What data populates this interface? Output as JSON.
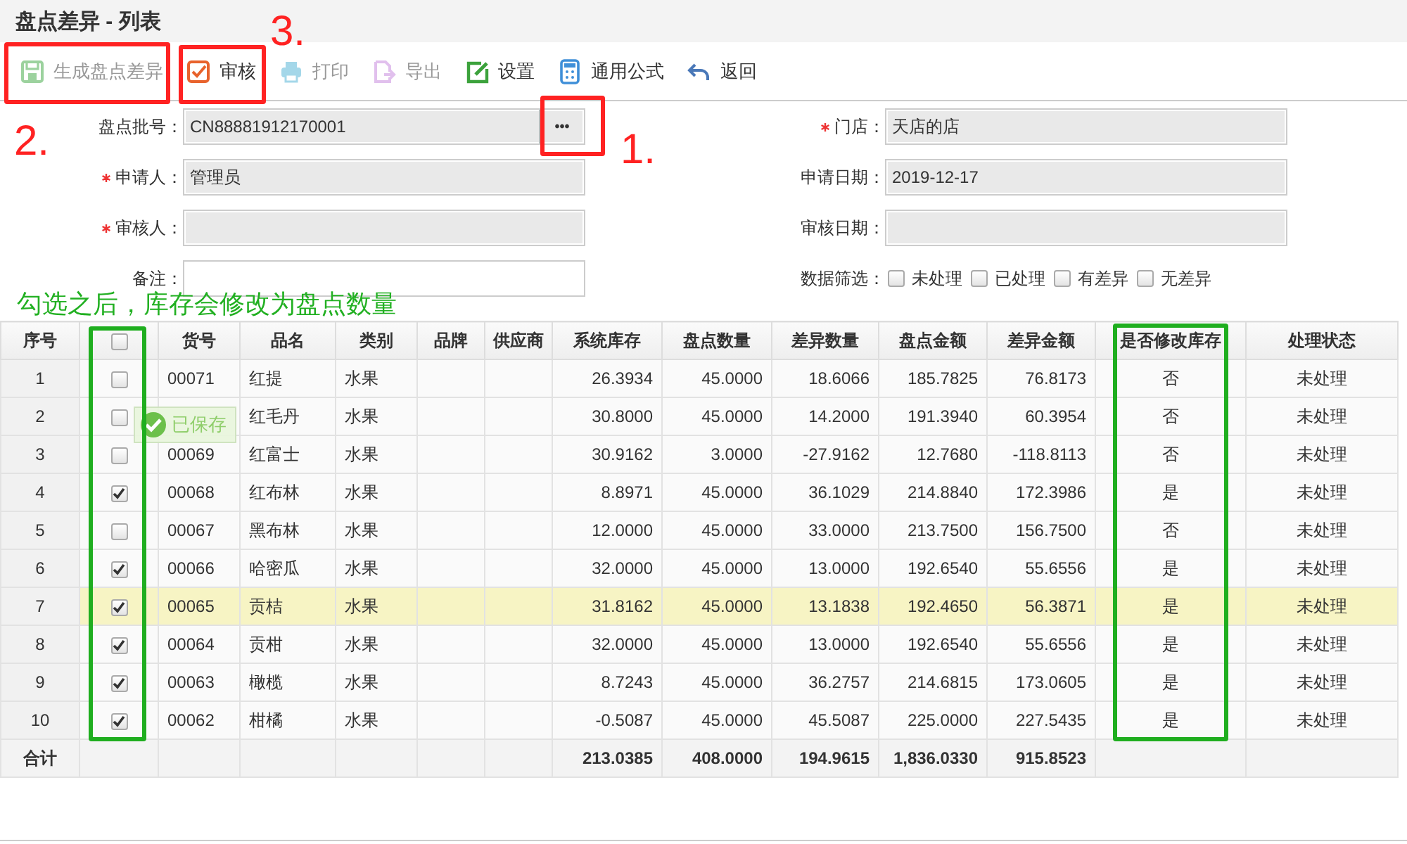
{
  "window": {
    "title": "盘点差异 - 列表"
  },
  "toolbar": [
    {
      "label": "生成盘点差异",
      "kind": "save",
      "disabled": true
    },
    {
      "label": "审核",
      "kind": "check",
      "disabled": false
    },
    {
      "label": "打印",
      "kind": "print",
      "disabled": true
    },
    {
      "label": "导出",
      "kind": "export",
      "disabled": true
    },
    {
      "label": "设置",
      "kind": "edit",
      "disabled": false
    },
    {
      "label": "通用公式",
      "kind": "calc",
      "disabled": false
    },
    {
      "label": "返回",
      "kind": "back",
      "disabled": false
    }
  ],
  "form": {
    "left": [
      {
        "label": "盘点批号：",
        "required": false,
        "value": "CN88881912170001",
        "lookup": "•••"
      },
      {
        "label": "申请人：",
        "required": true,
        "value": "管理员"
      },
      {
        "label": "审核人：",
        "required": true
      },
      {
        "label": "备注：",
        "required": false,
        "editable": true
      }
    ],
    "right": [
      {
        "label": "门店：",
        "required": true,
        "value": "天店的店"
      },
      {
        "label": "申请日期：",
        "required": false,
        "value": "2019-12-17"
      },
      {
        "label": "审核日期：",
        "required": false
      }
    ],
    "filter": {
      "label": "数据筛选：",
      "options": [
        {
          "label": "未处理",
          "checked": false
        },
        {
          "label": "已处理",
          "checked": false
        },
        {
          "label": "有差异",
          "checked": false
        },
        {
          "label": "无差异",
          "checked": false
        }
      ]
    }
  },
  "table": {
    "columns": [
      "序号",
      "货号",
      "品名",
      "类别",
      "品牌",
      "供应商",
      "系统库存",
      "盘点数量",
      "差异数量",
      "盘点金额",
      "差异金额",
      "是否修改库存",
      "处理状态"
    ],
    "header_checked": false,
    "rows": [
      {
        "no": "1",
        "checked": false,
        "selected": false,
        "code": "00071",
        "name": "红提",
        "category": "水果",
        "system_stock": "26.3934",
        "count_qty": "45.0000",
        "diff_qty": "18.6066",
        "count_amount": "185.7825",
        "diff_amount": "76.8173",
        "modify_stock": "否",
        "status": "未处理"
      },
      {
        "no": "2",
        "checked": false,
        "selected": false,
        "name": "红毛丹",
        "category": "水果",
        "system_stock": "30.8000",
        "count_qty": "45.0000",
        "diff_qty": "14.2000",
        "count_amount": "191.3940",
        "diff_amount": "60.3954",
        "modify_stock": "否",
        "status": "未处理"
      },
      {
        "no": "3",
        "checked": false,
        "selected": false,
        "code": "00069",
        "name": "红富士",
        "category": "水果",
        "system_stock": "30.9162",
        "count_qty": "3.0000",
        "diff_qty": "-27.9162",
        "count_amount": "12.7680",
        "diff_amount": "-118.8113",
        "modify_stock": "否",
        "status": "未处理"
      },
      {
        "no": "4",
        "checked": true,
        "selected": false,
        "code": "00068",
        "name": "红布林",
        "category": "水果",
        "system_stock": "8.8971",
        "count_qty": "45.0000",
        "diff_qty": "36.1029",
        "count_amount": "214.8840",
        "diff_amount": "172.3986",
        "modify_stock": "是",
        "status": "未处理"
      },
      {
        "no": "5",
        "checked": false,
        "selected": false,
        "code": "00067",
        "name": "黑布林",
        "category": "水果",
        "system_stock": "12.0000",
        "count_qty": "45.0000",
        "diff_qty": "33.0000",
        "count_amount": "213.7500",
        "diff_amount": "156.7500",
        "modify_stock": "否",
        "status": "未处理"
      },
      {
        "no": "6",
        "checked": true,
        "selected": false,
        "code": "00066",
        "name": "哈密瓜",
        "category": "水果",
        "system_stock": "32.0000",
        "count_qty": "45.0000",
        "diff_qty": "13.0000",
        "count_amount": "192.6540",
        "diff_amount": "55.6556",
        "modify_stock": "是",
        "status": "未处理"
      },
      {
        "no": "7",
        "checked": true,
        "selected": true,
        "code": "00065",
        "name": "贡桔",
        "category": "水果",
        "system_stock": "31.8162",
        "count_qty": "45.0000",
        "diff_qty": "13.1838",
        "count_amount": "192.4650",
        "diff_amount": "56.3871",
        "modify_stock": "是",
        "status": "未处理"
      },
      {
        "no": "8",
        "checked": true,
        "selected": false,
        "code": "00064",
        "name": "贡柑",
        "category": "水果",
        "system_stock": "32.0000",
        "count_qty": "45.0000",
        "diff_qty": "13.0000",
        "count_amount": "192.6540",
        "diff_amount": "55.6556",
        "modify_stock": "是",
        "status": "未处理"
      },
      {
        "no": "9",
        "checked": true,
        "selected": false,
        "code": "00063",
        "name": "橄榄",
        "category": "水果",
        "system_stock": "8.7243",
        "count_qty": "45.0000",
        "diff_qty": "36.2757",
        "count_amount": "214.6815",
        "diff_amount": "173.0605",
        "modify_stock": "是",
        "status": "未处理"
      },
      {
        "no": "10",
        "checked": true,
        "selected": false,
        "code": "00062",
        "name": "柑橘",
        "category": "水果",
        "system_stock": "-0.5087",
        "count_qty": "45.0000",
        "diff_qty": "45.5087",
        "count_amount": "225.0000",
        "diff_amount": "227.5435",
        "modify_stock": "是",
        "status": "未处理"
      }
    ],
    "totals": {
      "label": "合计",
      "system_stock": "213.0385",
      "count_qty": "408.0000",
      "diff_qty": "194.9615",
      "count_amount": "1,836.0330",
      "diff_amount": "915.8523"
    }
  },
  "toast": {
    "text": "已保存"
  },
  "annotations": {
    "steps": [
      "1.",
      "2.",
      "3."
    ],
    "note": "勾选之后，库存会修改为盘点数量"
  }
}
